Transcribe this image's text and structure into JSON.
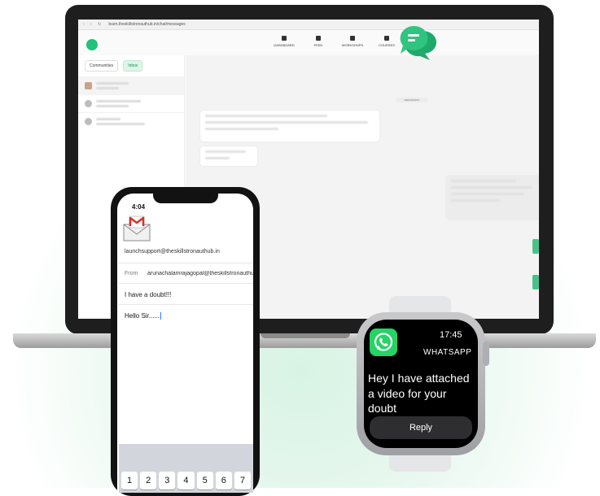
{
  "laptop": {
    "url": "learn.theskillstronauthub.in/chat/messages",
    "nav": [
      "DASHBOARD",
      "FEED",
      "WORKSHOPS",
      "COURSES"
    ],
    "tabs": [
      "Communities",
      "Inbox"
    ],
    "active_tab": "Inbox",
    "date_chip": "WEDNESDAY"
  },
  "phone": {
    "time": "4:04",
    "to": "launchsupport@theskillstronauthub.in",
    "from_label": "From",
    "from": "arunachalamrajagopal@theskillstronauthub.in",
    "subject": "I have a doubt!!!",
    "body": "Hello Sir......",
    "keys": [
      "1",
      "2",
      "3",
      "4",
      "5",
      "6",
      "7"
    ]
  },
  "watch": {
    "time": "17:45",
    "app": "WHATSAPP",
    "message": "Hey I have attached a video for your doubt",
    "reply": "Reply"
  },
  "colors": {
    "brand_green": "#22c27a",
    "whatsapp_green": "#25d366",
    "gmail_red": "#d93025"
  }
}
